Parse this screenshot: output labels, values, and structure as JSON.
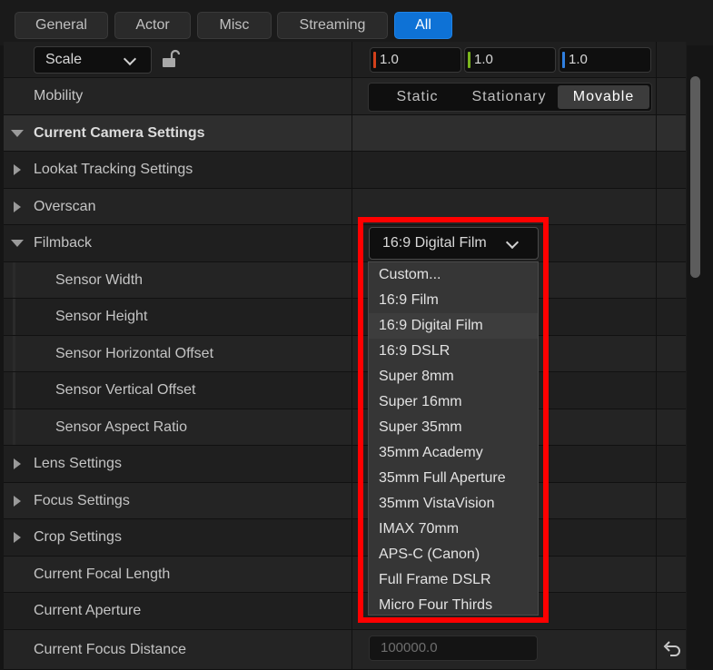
{
  "tabs": [
    "General",
    "Actor",
    "Misc",
    "Streaming",
    "All"
  ],
  "active_tab": "All",
  "scale": {
    "label": "Scale",
    "values": [
      "1.0",
      "1.0",
      "1.0"
    ]
  },
  "colors": {
    "x_axis": "#d3401b",
    "y_axis": "#7ab51d",
    "z_axis": "#2f7fe0",
    "highlight": "#ff0000",
    "accent": "#0e72d6"
  },
  "mobility": {
    "label": "Mobility",
    "options": [
      "Static",
      "Stationary",
      "Movable"
    ],
    "selected": "Movable"
  },
  "section": {
    "title": "Current Camera Settings"
  },
  "rows": {
    "lookat": "Lookat Tracking Settings",
    "overscan": "Overscan",
    "filmback": "Filmback",
    "sensor_width": "Sensor Width",
    "sensor_height": "Sensor Height",
    "sensor_h_offset": "Sensor Horizontal Offset",
    "sensor_v_offset": "Sensor Vertical Offset",
    "sensor_aspect": "Sensor Aspect Ratio",
    "lens": "Lens Settings",
    "focus": "Focus Settings",
    "crop": "Crop Settings",
    "focal_length": "Current Focal Length",
    "aperture": "Current Aperture",
    "focus_distance": "Current Focus Distance"
  },
  "filmback_preset": {
    "selected": "16:9 Digital Film",
    "options": [
      "Custom...",
      "16:9 Film",
      "16:9 Digital Film",
      "16:9 DSLR",
      "Super 8mm",
      "Super 16mm",
      "Super 35mm",
      "35mm Academy",
      "35mm Full Aperture",
      "35mm VistaVision",
      "IMAX 70mm",
      "APS-C (Canon)",
      "Full Frame DSLR",
      "Micro Four Thirds"
    ]
  },
  "focus_distance_value": "100000.0"
}
